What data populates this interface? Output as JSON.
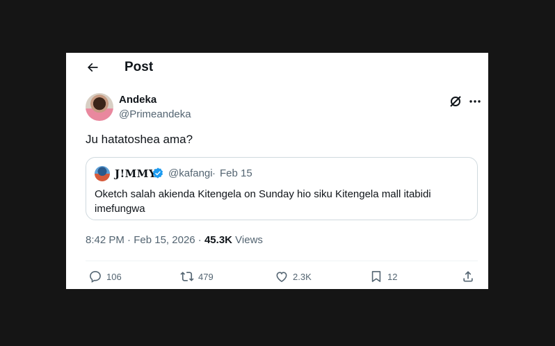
{
  "header": {
    "title": "Post"
  },
  "author": {
    "name": "Andeka",
    "handle": "@Primeandeka"
  },
  "tweet": {
    "text": "Ju hatatoshea ama?"
  },
  "quote": {
    "name": "J!MMY",
    "handle": "@kafangi",
    "separator": "·",
    "date": "Feb 15",
    "text": "Oketch salah akienda Kitengela on Sunday hio siku Kitengela mall itabidi imefungwa"
  },
  "meta": {
    "time": "8:42 PM",
    "sep1": " · ",
    "date": "Feb 15, 2026",
    "sep2": " · ",
    "views_count": "45.3K",
    "views_label": " Views"
  },
  "actions": {
    "replies": "106",
    "reposts": "479",
    "likes": "2.3K",
    "bookmarks": "12"
  },
  "colors": {
    "text": "#0f1419",
    "secondary": "#536471",
    "verified": "#1d9bf0",
    "border": "#cfd9de"
  }
}
